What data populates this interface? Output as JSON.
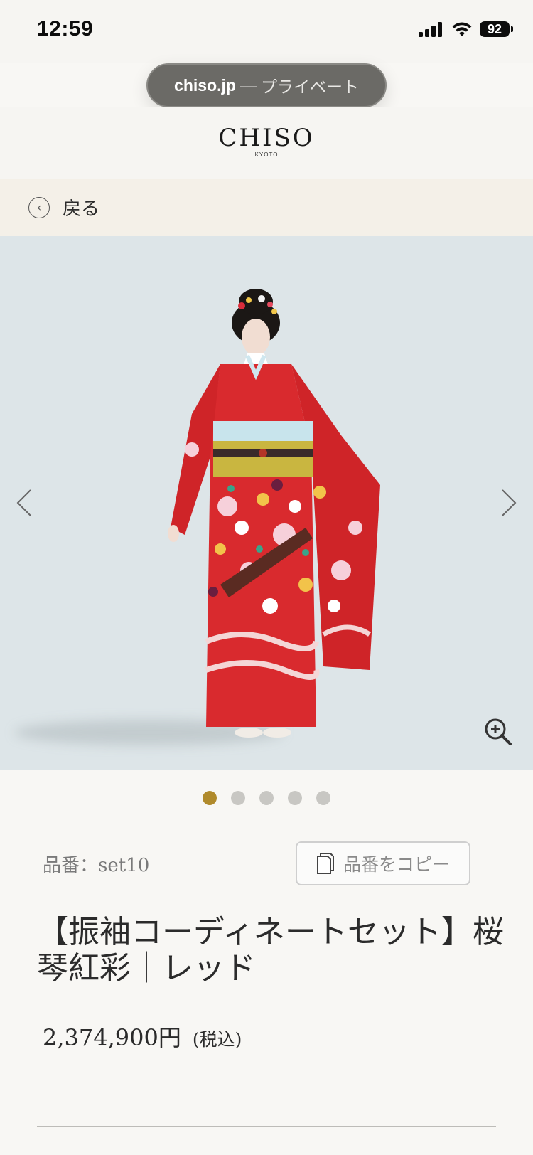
{
  "status_bar": {
    "time": "12:59",
    "battery": "92"
  },
  "browser": {
    "domain": "chiso.jp",
    "separator": "—",
    "mode": "プライベート"
  },
  "header": {
    "logo": "CHISO",
    "logo_sub": "KYOTO"
  },
  "nav": {
    "back_label": "戻る"
  },
  "carousel": {
    "active_index": 0,
    "total": 5,
    "colors": {
      "background": "#dde5e8",
      "active_dot": "#b08a2b",
      "inactive_dot": "#c8c7c3"
    }
  },
  "product": {
    "sku": "品番：set10",
    "copy_button": "品番をコピー",
    "title": "【振袖コーディネートセット】桜琴紅彩｜レッド",
    "price": "2,374,900円",
    "tax_note": "(税込)"
  },
  "icons": {
    "back": "back-circle-icon",
    "prev": "chevron-left-icon",
    "next": "chevron-right-icon",
    "zoom": "zoom-in-icon",
    "copy": "copy-icon"
  }
}
